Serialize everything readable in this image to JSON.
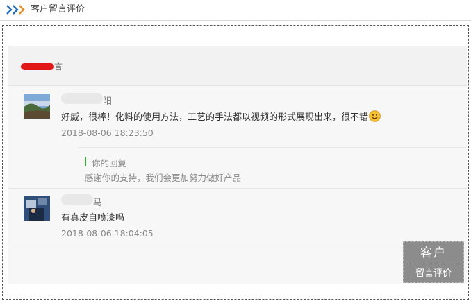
{
  "header": {
    "title": "客户留言评价",
    "icon": "triple-chevron-right-icon"
  },
  "panel": {
    "bar_label": "言"
  },
  "messages": [
    {
      "username": "阳",
      "content": "好威，很棒！化料的使用方法，工艺的手法都以视频的形式展现出来，很不错",
      "emoji": "smiley-face-icon",
      "time": "2018-08-06 18:23:50",
      "reply": {
        "label": "你的回复",
        "text": "感谢你的支持，我们会更加努力做好产品"
      }
    },
    {
      "username": "马",
      "content": "有真皮自喷漆吗",
      "time": "2018-08-06 18:04:05"
    }
  ],
  "float_button": {
    "top": "客户",
    "bottom": "留言评价"
  },
  "colors": {
    "accent_green": "#3ca63c",
    "chevron_blue": "#1f6fbf",
    "chevron_orange": "#f08c1e",
    "redaction": "#e01818"
  }
}
